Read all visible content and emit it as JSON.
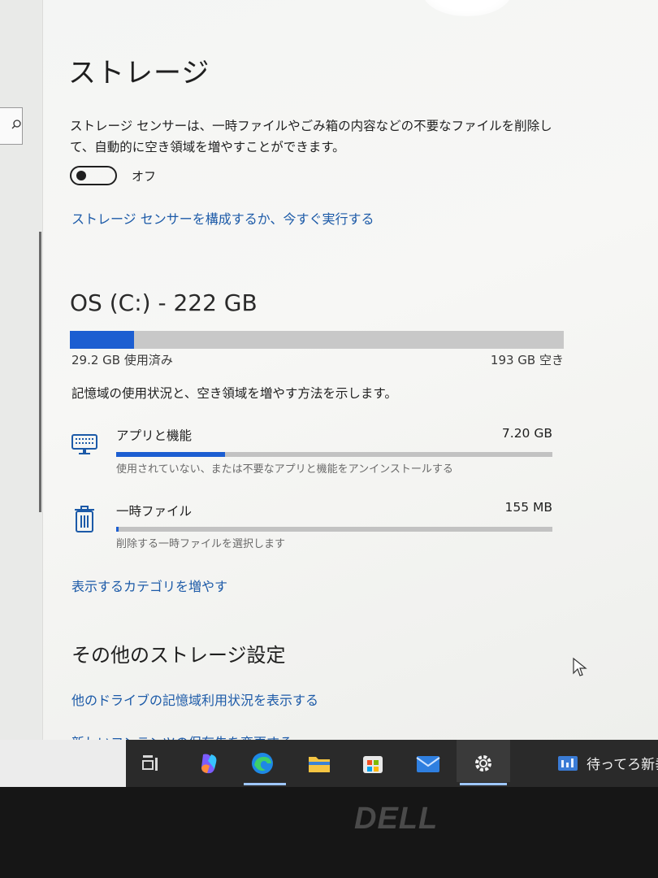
{
  "settings": {
    "title": "ストレージ",
    "storage_sense_description": "ストレージ センサーは、一時ファイルやごみ箱の内容などの不要なファイルを削除して、自動的に空き領域を増やすことができます。",
    "toggle": {
      "state": "off",
      "label": "オフ"
    },
    "configure_link": "ストレージ センサーを構成するか、今すぐ実行する"
  },
  "drive": {
    "title": "OS (C:) - 222 GB",
    "used_label": "29.2 GB 使用済み",
    "free_label": "193 GB 空き",
    "used_fraction": 0.13,
    "usage_description": "記憶域の使用状況と、空き領域を増やす方法を示します。",
    "categories": [
      {
        "name": "アプリと機能",
        "size": "7.20 GB",
        "subtext": "使用されていない、または不要なアプリと機能をアンインストールする",
        "fill_fraction": 0.25,
        "icon": "keyboard-icon"
      },
      {
        "name": "一時ファイル",
        "size": "155 MB",
        "subtext": "削除する一時ファイルを選択します",
        "fill_fraction": 0.005,
        "icon": "trash-icon"
      }
    ],
    "show_more_link": "表示するカテゴリを増やす"
  },
  "other_settings": {
    "title": "その他のストレージ設定",
    "link_other_drives": "他のドライブの記憶域利用状況を表示する",
    "link_save_location": "新しいコンテンツの保存先を変更する"
  },
  "taskbar": {
    "icons": [
      "task-view-icon",
      "copilot-icon",
      "edge-icon",
      "file-explorer-icon",
      "store-icon",
      "mail-icon",
      "settings-icon",
      "news-icon"
    ],
    "news_text": "待ってろ新垂"
  },
  "bezel": {
    "brand": "DELL"
  },
  "colors": {
    "accent": "#1c5ed1",
    "link": "#1c5aa8",
    "bar_bg": "#c8c8c8"
  }
}
